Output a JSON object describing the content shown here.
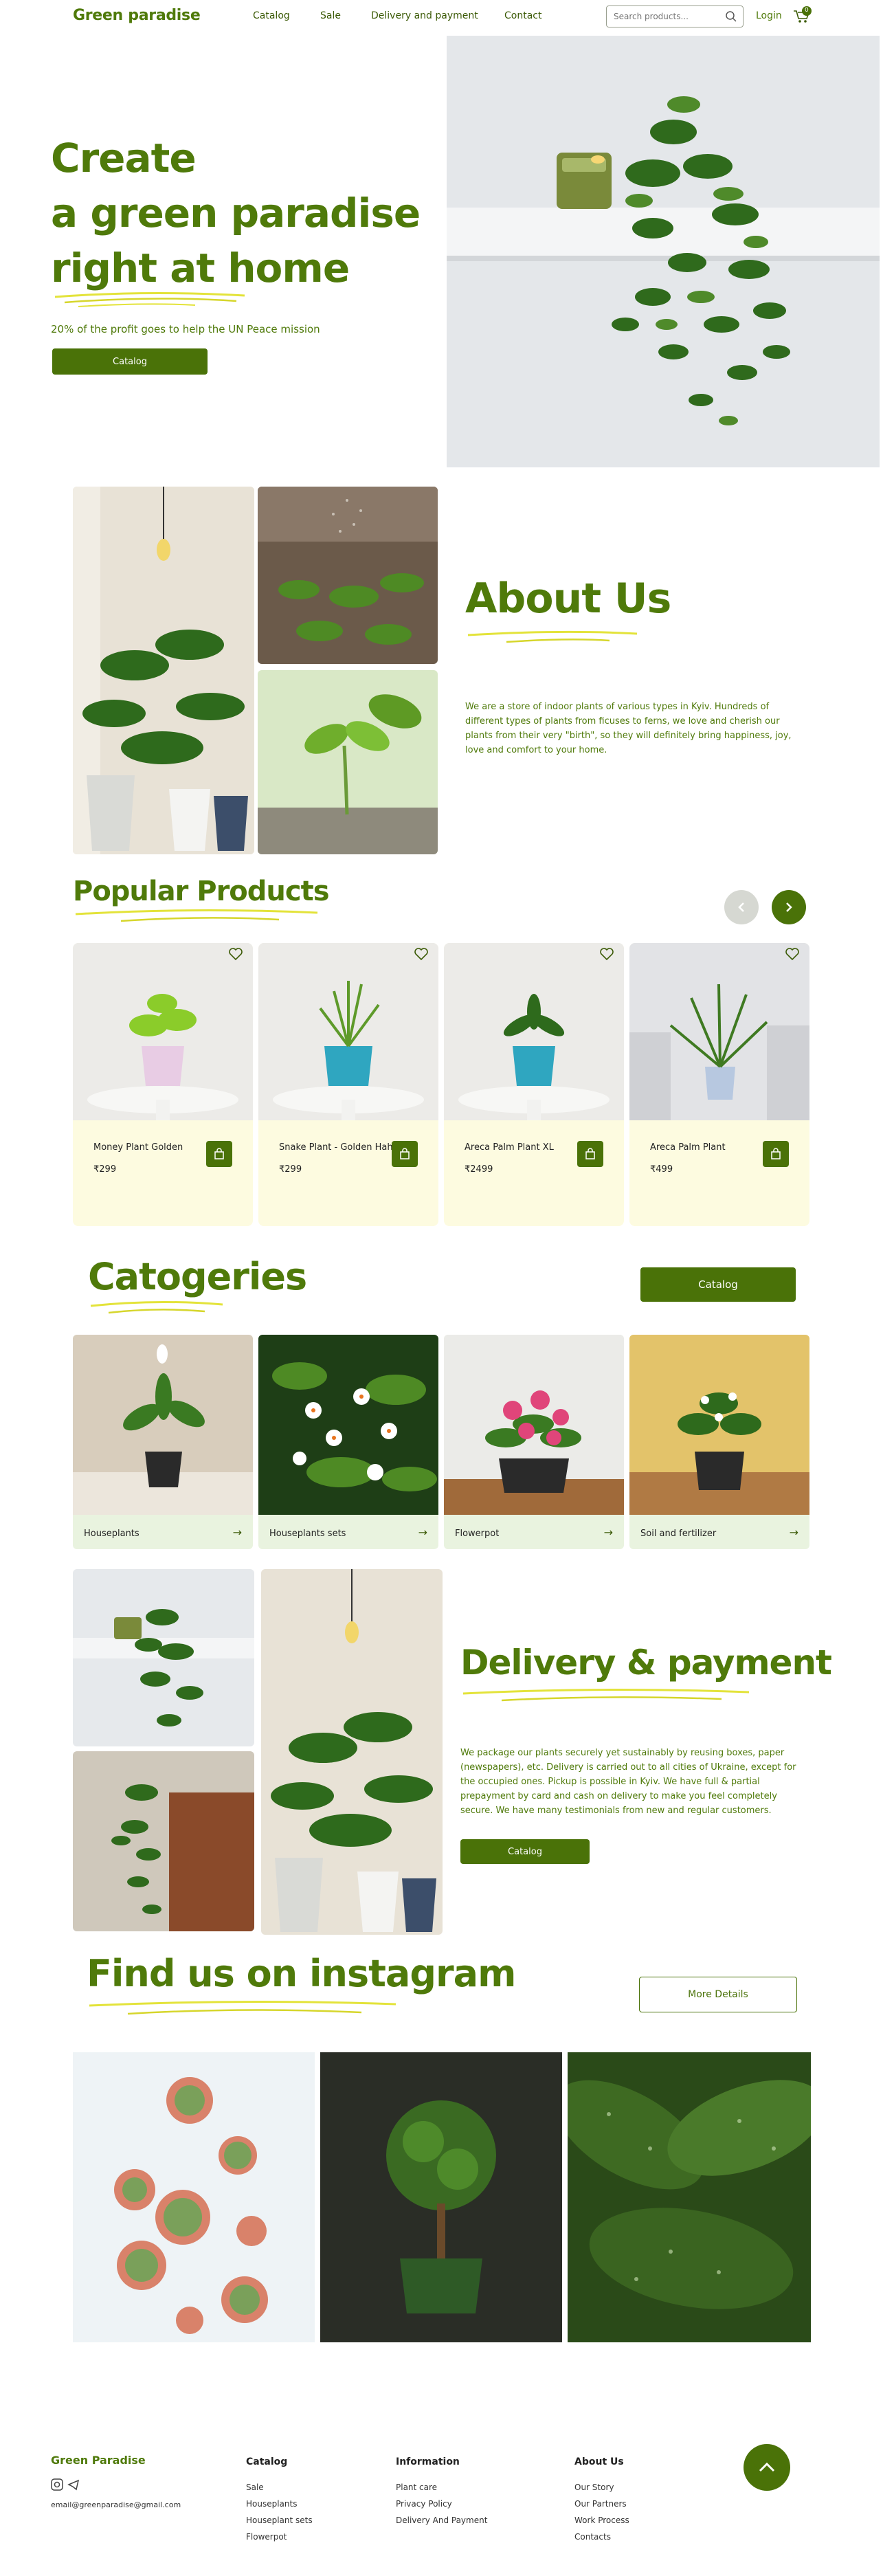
{
  "header": {
    "logo": "Green paradise",
    "nav": [
      "Catalog",
      "Sale",
      "Delivery and payment",
      "Contact"
    ],
    "search_placeholder": "Search products...",
    "login": "Login",
    "cart_count": "0"
  },
  "hero": {
    "title_line1": "Create",
    "title_line2": "a green paradise",
    "title_line3": "right at home",
    "subtitle": "20% of the profit goes to help the UN Peace mission",
    "button": "Catalog"
  },
  "about": {
    "title": "About Us",
    "text": "We are a store of indoor plants of various types in Kyiv. Hundreds of different types of plants from ficuses to ferns, we love and cherish our plants from their very \"birth\", so they will definitely bring happiness, joy, love and comfort to your home."
  },
  "popular": {
    "title": "Popular Products",
    "products": [
      {
        "name": "Money Plant Golden",
        "price": "₹299"
      },
      {
        "name": "Snake Plant - Golden Hahnii",
        "price": "₹299"
      },
      {
        "name": "Areca Palm Plant XL",
        "price": "₹2499"
      },
      {
        "name": "Areca Palm Plant",
        "price": "₹499"
      }
    ]
  },
  "categories": {
    "title": "Catogeries",
    "button": "Catalog",
    "items": [
      {
        "label": "Houseplants"
      },
      {
        "label": "Houseplants sets"
      },
      {
        "label": "Flowerpot"
      },
      {
        "label": "Soil and fertilizer"
      }
    ]
  },
  "delivery": {
    "title": "Delivery & payment",
    "text": "We package our plants securely yet sustainably by reusing boxes, paper (newspapers), etc. Delivery is carried out to all cities of Ukraine, except for the occupied ones. Pickup is possible in Kyiv. We have full & partial prepayment by card and cash on delivery to make you feel completely secure. We have many testimonials from new and regular customers.",
    "button": "Catalog"
  },
  "instagram": {
    "title": "Find us on instagram",
    "button": "More Details"
  },
  "footer": {
    "brand": "Green Paradise",
    "email": "email@greenparadise@gmail.com",
    "col1": {
      "title": "Catalog",
      "links": [
        "Sale",
        "Houseplants",
        "Houseplant sets",
        "Flowerpot"
      ]
    },
    "col2": {
      "title": "Information",
      "links": [
        "Plant care",
        "Privacy Policy",
        "Delivery And Payment"
      ]
    },
    "col3": {
      "title": "About Us",
      "links": [
        "Our Story",
        "Our Partners",
        "Work Process",
        "Contacts"
      ]
    }
  },
  "colors": {
    "brand_green": "#4a7208",
    "card_cream": "#fdfbe0",
    "category_mint": "#e9f3df",
    "underline_yellow": "#e3e33a"
  }
}
